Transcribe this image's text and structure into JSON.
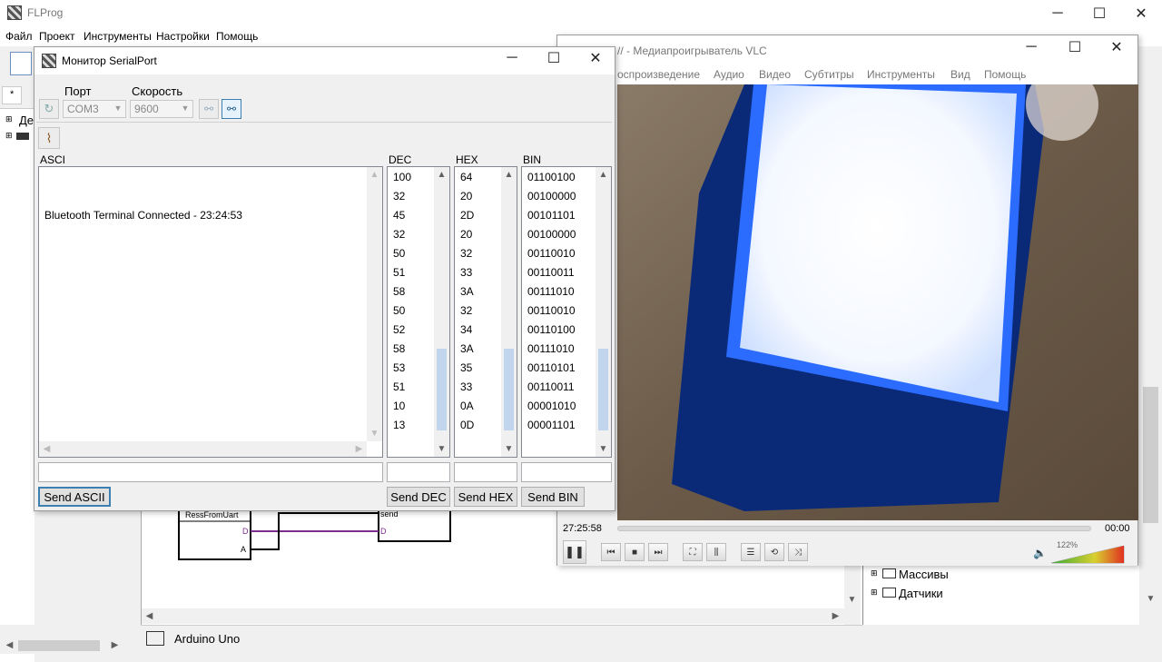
{
  "main_window": {
    "title": "FLProg",
    "menu": [
      "Файл",
      "Проект",
      "Инструменты",
      "Настройки",
      "Помощь"
    ],
    "tab_label": "*",
    "tree_partial_label": "Де",
    "canvas": {
      "block1_title": "RessFromUart",
      "block1_port_d": "D",
      "block1_port_a": "A",
      "block2_title": "send",
      "block2_port_d": "D"
    },
    "status_board": "Arduino Uno",
    "right_tree": [
      "Массивы",
      "Датчики"
    ]
  },
  "serial_monitor": {
    "title": "Монитор SerialPort",
    "port_label": "Порт",
    "port_value": "COM3",
    "speed_label": "Скорость",
    "speed_value": "9600",
    "col_ascii": "ASCI",
    "col_dec": "DEC",
    "col_hex": "HEX",
    "col_bin": "BIN",
    "ascii_text": "Bluetooth Terminal Connected - 23:24:53",
    "dec": [
      "100",
      "32",
      "45",
      "32",
      "50",
      "51",
      "58",
      "50",
      "52",
      "58",
      "53",
      "51",
      "10",
      "13"
    ],
    "hex": [
      "64",
      "20",
      "2D",
      "20",
      "32",
      "33",
      "3A",
      "32",
      "34",
      "3A",
      "35",
      "33",
      "0A",
      "0D"
    ],
    "bin": [
      "01100100",
      "00100000",
      "00101101",
      "00100000",
      "00110010",
      "00110011",
      "00111010",
      "00110010",
      "00110100",
      "00111010",
      "00110101",
      "00110011",
      "00001010",
      "00001101"
    ],
    "send_ascii": "Send ASCII",
    "send_dec": "Send DEC",
    "send_hex": "Send HEX",
    "send_bin": "Send BIN"
  },
  "vlc": {
    "title": "// - Медиапроигрыватель VLC",
    "menu": [
      "оспроизведение",
      "Аудио",
      "Видео",
      "Субтитры",
      "Инструменты",
      "Вид",
      "Помощь"
    ],
    "time_elapsed": "27:25:58",
    "time_total": "00:00",
    "volume": "122%"
  }
}
